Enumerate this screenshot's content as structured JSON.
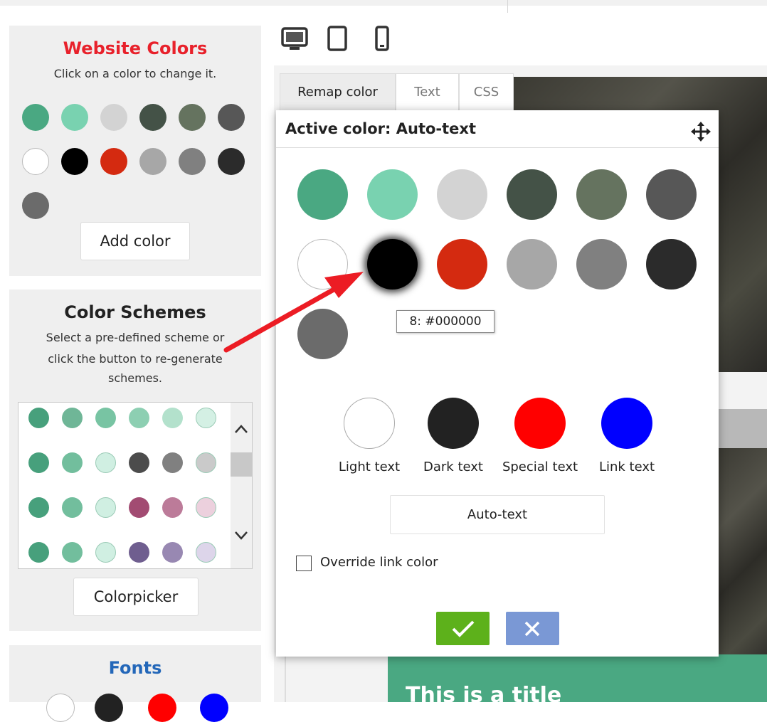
{
  "sidebar": {
    "website_colors": {
      "title": "Website Colors",
      "title_color": "#e8212b",
      "subtitle": "Click on a color to change it.",
      "swatches": [
        "#4aa882",
        "#79d2b0",
        "#d3d3d3",
        "#445247",
        "#65735f",
        "#575757",
        "#ffffff",
        "#000000",
        "#d42a10",
        "#a7a7a7",
        "#808080",
        "#2b2b2b",
        "#6b6b6b"
      ],
      "add_button": "Add color"
    },
    "color_schemes": {
      "title": "Color Schemes",
      "subtitle_line1": "Select a pre-defined scheme or",
      "subtitle_line2": "click the button to re-generate",
      "subtitle_line3": "schemes.",
      "rows": [
        [
          "#47a07c",
          "#6fb697",
          "#78c4a3",
          "#8dcfb2",
          "#b3e1cc",
          "#d4f0e4"
        ],
        [
          "#47a07c",
          "#72be9d",
          "#d0efe2",
          "#4c4c4c",
          "#808080",
          "#cacaca"
        ],
        [
          "#47a07c",
          "#72be9d",
          "#d0efe2",
          "#a24b72",
          "#bc7b99",
          "#ecd0dd"
        ],
        [
          "#47a07c",
          "#72be9d",
          "#d0efe2",
          "#6f5e8f",
          "#9888b2",
          "#ddd5ea"
        ]
      ],
      "button": "Colorpicker"
    },
    "fonts": {
      "title": "Fonts",
      "title_color": "#2367b9"
    }
  },
  "dialog": {
    "tabs": [
      "Remap color",
      "Text",
      "CSS"
    ],
    "header": "Active color: Auto-text",
    "palette": [
      "#4aa882",
      "#79d2b0",
      "#d3d3d3",
      "#445247",
      "#65735f",
      "#575757",
      "#ffffff",
      "#000000",
      "#d42a10",
      "#a7a7a7",
      "#808080",
      "#2b2b2b",
      "#6b6b6b"
    ],
    "tooltip": "8: #000000",
    "text_colors": [
      {
        "label": "Light text",
        "color": "#ffffff"
      },
      {
        "label": "Dark text",
        "color": "#222222"
      },
      {
        "label": "Special text",
        "color": "#ff0000"
      },
      {
        "label": "Link text",
        "color": "#0000ff"
      }
    ],
    "auto_button": "Auto-text",
    "override_label": "Override link color",
    "confirm_color": "#5db11b",
    "cancel_color": "#7a98d5"
  },
  "preview": {
    "title": "This is a title"
  }
}
